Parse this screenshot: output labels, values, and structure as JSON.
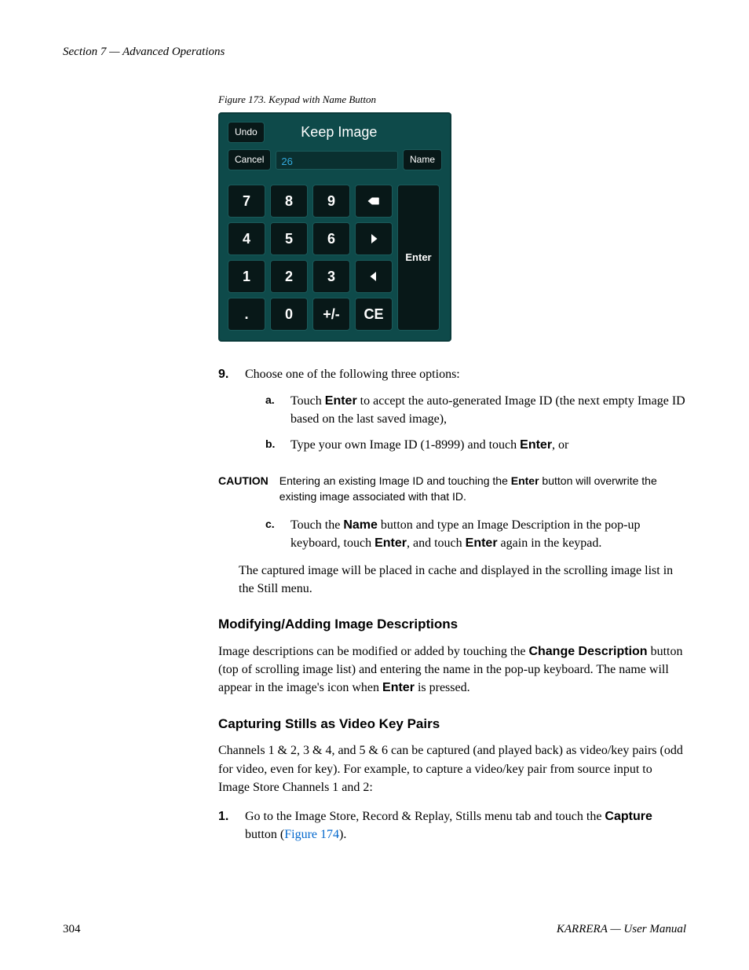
{
  "header": "Section 7 — Advanced Operations",
  "figure": {
    "caption": "Figure 173.  Keypad with Name Button",
    "title": "Keep Image",
    "undo": "Undo",
    "cancel": "Cancel",
    "name": "Name",
    "input_value": "26",
    "keys": {
      "r0": [
        "7",
        "8",
        "9"
      ],
      "r1": [
        "4",
        "5",
        "6"
      ],
      "r2": [
        "1",
        "2",
        "3"
      ],
      "r3": [
        ".",
        "0",
        "+/-",
        "CE"
      ]
    },
    "enter": "Enter"
  },
  "steps": {
    "s9": {
      "num": "9.",
      "text": "Choose one of the following three options:",
      "a": {
        "num": "a.",
        "pre": "Touch ",
        "b1": "Enter",
        "post": " to accept the auto-generated Image ID (the next empty Image ID based on the last saved image),"
      },
      "b": {
        "num": "b.",
        "pre": "Type your own Image ID (1-8999) and touch ",
        "b1": "Enter",
        "post": ", or"
      },
      "c": {
        "num": "c.",
        "pre": "Touch the ",
        "b1": "Name",
        "mid": " button and type an Image Description in the pop-up keyboard, touch ",
        "b2": "Enter",
        "mid2": ", and touch ",
        "b3": "Enter",
        "post": " again in the keypad."
      }
    },
    "caution": {
      "label": "CAUTION",
      "pre": "Entering an existing Image ID and touching the ",
      "b1": "Enter",
      "post": " button will overwrite the existing image associated with that ID."
    },
    "result": "The captured image will be placed in cache and displayed in the scrolling image list in the Still menu."
  },
  "modify": {
    "heading": "Modifying/Adding Image Descriptions",
    "p_pre": "Image descriptions can be modified or added by touching the ",
    "b1": "Change Description",
    "p_mid": " button (top of scrolling image list) and entering the name in the pop-up keyboard. The name will appear in the image's icon when ",
    "b2": "Enter",
    "p_post": " is pressed."
  },
  "capture": {
    "heading": "Capturing Stills as Video Key Pairs",
    "p1": "Channels 1 & 2, 3 & 4, and 5 & 6 can be captured (and played back) as video/key pairs (odd for video, even for key). For example, to capture a video/key pair from source input to Image Store Channels 1 and 2:",
    "s1": {
      "num": "1.",
      "pre": "Go to the Image Store, Record & Replay, Stills menu tab and touch the ",
      "b1": "Capture",
      "mid": " button (",
      "link": "Figure 174",
      "post": ")."
    }
  },
  "footer": {
    "page": "304",
    "right": "KARRERA  —  User Manual"
  }
}
